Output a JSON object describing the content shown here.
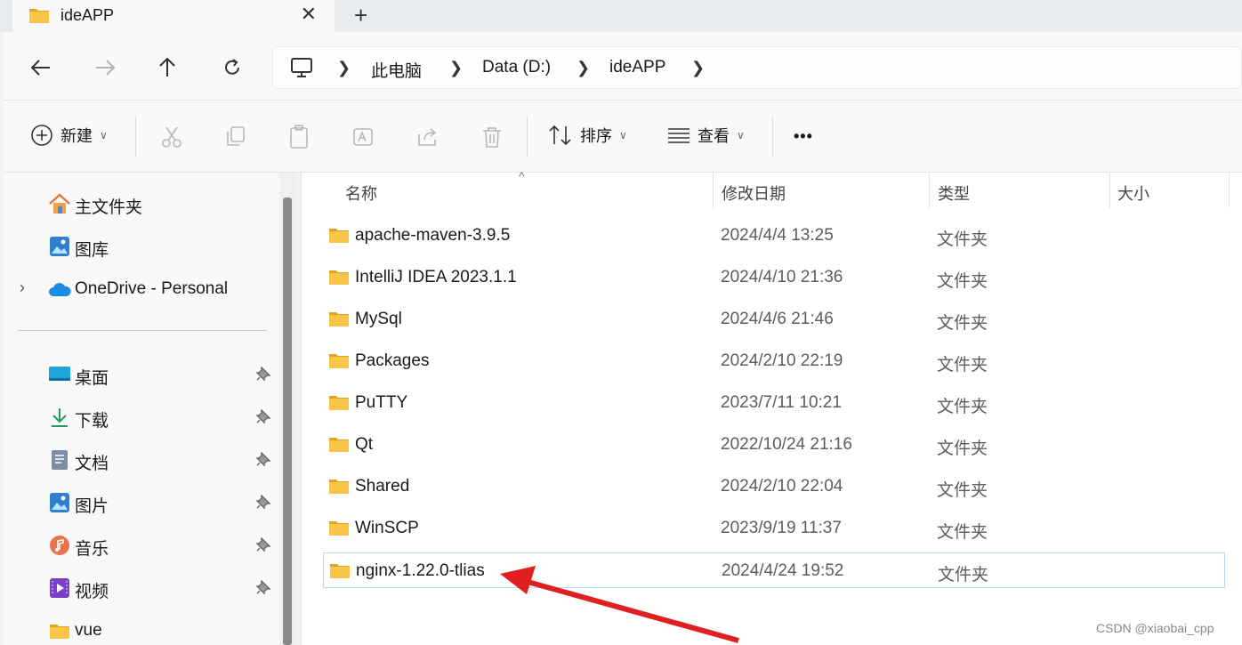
{
  "tab": {
    "title": "ideAPP",
    "close": "✕",
    "new_tab": "+"
  },
  "nav": {
    "back": "←",
    "forward": "→",
    "up": "↑",
    "refresh": "↻"
  },
  "breadcrumb": [
    "此电脑",
    "Data (D:)",
    "ideAPP"
  ],
  "toolbar": {
    "new_label": "新建",
    "sort_label": "排序",
    "view_label": "查看",
    "more": "•••"
  },
  "sidebar": {
    "top_items": [
      {
        "label": "主文件夹",
        "icon": "home-icon"
      },
      {
        "label": "图库",
        "icon": "gallery-icon"
      },
      {
        "label": "OneDrive - Personal",
        "icon": "onedrive-icon"
      }
    ],
    "pinned_items": [
      {
        "label": "桌面",
        "icon": "desktop-icon"
      },
      {
        "label": "下载",
        "icon": "download-icon"
      },
      {
        "label": "文档",
        "icon": "documents-icon"
      },
      {
        "label": "图片",
        "icon": "pictures-icon"
      },
      {
        "label": "音乐",
        "icon": "music-icon"
      },
      {
        "label": "视频",
        "icon": "videos-icon"
      },
      {
        "label": "vue",
        "icon": "folder-icon"
      }
    ]
  },
  "columns": {
    "name": "名称",
    "modified": "修改日期",
    "type": "类型",
    "size": "大小"
  },
  "files": [
    {
      "name": "apache-maven-3.9.5",
      "modified": "2024/4/4 13:25",
      "type": "文件夹"
    },
    {
      "name": "IntelliJ IDEA 2023.1.1",
      "modified": "2024/4/10 21:36",
      "type": "文件夹"
    },
    {
      "name": "MySql",
      "modified": "2024/4/6 21:46",
      "type": "文件夹"
    },
    {
      "name": "Packages",
      "modified": "2024/2/10 22:19",
      "type": "文件夹"
    },
    {
      "name": "PuTTY",
      "modified": "2023/7/11 10:21",
      "type": "文件夹"
    },
    {
      "name": "Qt",
      "modified": "2022/10/24 21:16",
      "type": "文件夹"
    },
    {
      "name": "Shared",
      "modified": "2024/2/10 22:04",
      "type": "文件夹"
    },
    {
      "name": "WinSCP",
      "modified": "2023/9/19 11:37",
      "type": "文件夹"
    },
    {
      "name": "nginx-1.22.0-tlias",
      "modified": "2024/4/24 19:52",
      "type": "文件夹"
    }
  ],
  "watermark": "CSDN @xiaobai_cpp",
  "colors": {
    "folder": "#f8c546",
    "folder_dark": "#e0a526",
    "accent": "#0067c0",
    "arrow": "#e02020"
  }
}
